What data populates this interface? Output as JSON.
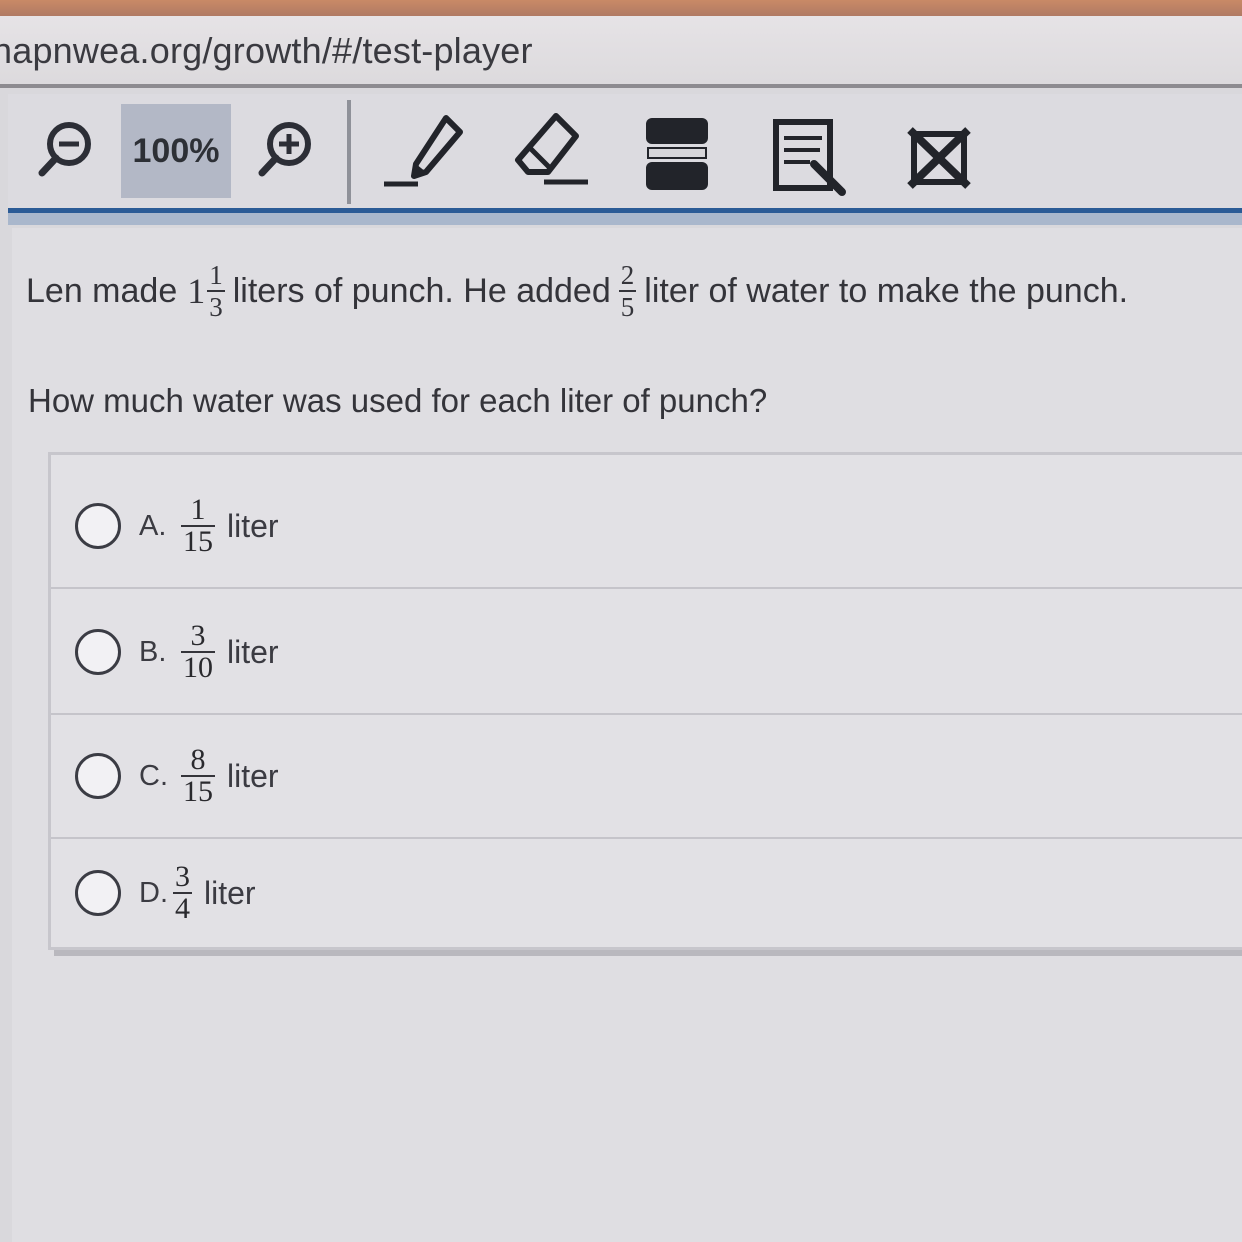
{
  "browser": {
    "url": "napnwea.org/growth/#/test-player"
  },
  "toolbar": {
    "zoom_out_icon": "zoom-out-icon",
    "zoom_level": "100%",
    "zoom_in_icon": "zoom-in-icon",
    "tools": [
      "pencil-icon",
      "eraser-icon",
      "line-reader-icon",
      "notepad-icon",
      "answer-eliminator-icon"
    ]
  },
  "question": {
    "stem_part1": "Len made",
    "mixed_whole": "1",
    "mixed_num": "1",
    "mixed_den": "3",
    "stem_part2": "liters of punch. He added",
    "added_num": "2",
    "added_den": "5",
    "stem_part3": "liter of water to make the punch.",
    "prompt": "How much water was used for each liter of punch?"
  },
  "answers": [
    {
      "letter": "A.",
      "num": "1",
      "den": "15",
      "unit": "liter",
      "selected": false
    },
    {
      "letter": "B.",
      "num": "3",
      "den": "10",
      "unit": "liter",
      "selected": false
    },
    {
      "letter": "C.",
      "num": "8",
      "den": "15",
      "unit": "liter",
      "selected": false
    },
    {
      "letter": "D.",
      "num": "3",
      "den": "4",
      "unit": "liter",
      "selected": false
    }
  ]
}
